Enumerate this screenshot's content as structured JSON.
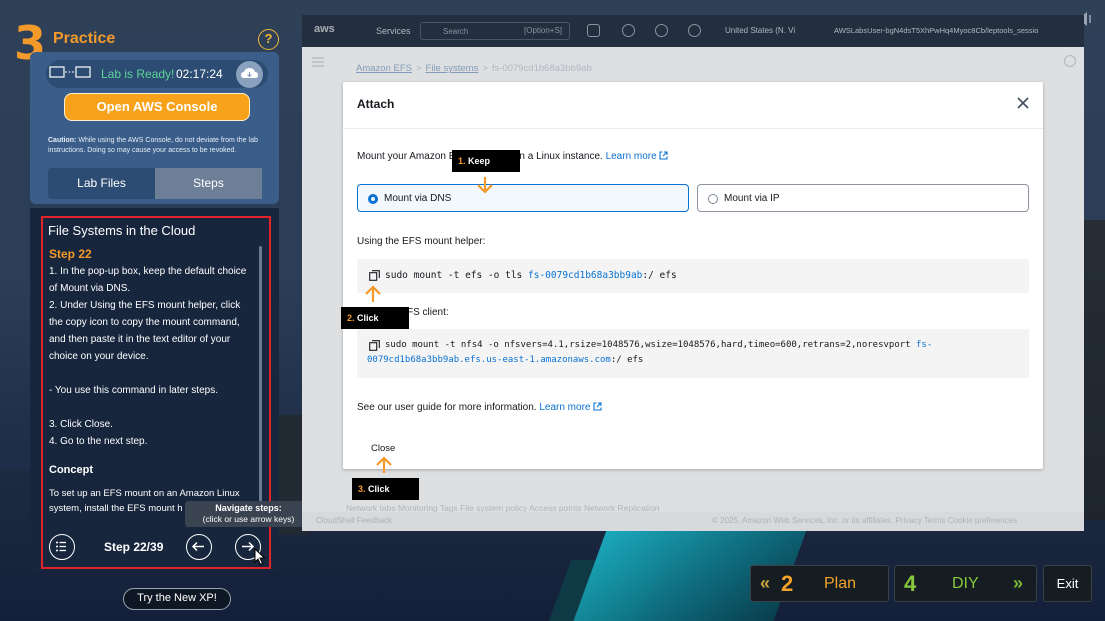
{
  "practice": {
    "number": "3",
    "title": "Practice",
    "help_label": "?"
  },
  "lab": {
    "status": "Lab is Ready!",
    "timer": "02:17:24",
    "open_console_label": "Open AWS Console",
    "caution_bold": "Caution:",
    "caution_text": "While using the AWS Console, do not deviate from the lab instructions. Doing so may cause your access to be revoked.",
    "tabs": [
      {
        "label": "Lab Files"
      },
      {
        "label": "Steps"
      }
    ]
  },
  "steps": {
    "title": "File Systems in the Cloud",
    "step_label": "Step 22",
    "lines": [
      "1. In the pop-up box, keep the default choice",
      "of Mount via DNS.",
      "2. Under Using the EFS mount helper, click",
      "the copy icon to copy the mount command,",
      "and then paste it in the text editor of your",
      "choice on your device.",
      "",
      "- You use this command in later steps.",
      "",
      "3. Click Close.",
      "4. Go to the next step."
    ],
    "concept_heading": "Concept",
    "concept_line1": "To set up an EFS mount on an Amazon Linux",
    "concept_line2": "system, install the EFS mount h",
    "tooltip_title": "Navigate steps:",
    "tooltip_sub": "(click or use arrow keys)",
    "counter": "Step 22/39",
    "try_new_xp": "Try the New XP!"
  },
  "console": {
    "top": {
      "logo": "aws",
      "services": "Services",
      "search_placeholder": "Search",
      "search_shortcut": "[Option+S]",
      "region": "United States (N. Vi",
      "user": "AWSLabsUser-bgN4dsT5XhPwHq4Myoc8Cb/leptools_sessio"
    },
    "breadcrumb": [
      "Amazon EFS",
      "File systems",
      "fs-0079cd1b68a3bb9ab"
    ],
    "behind_tabs": "Network tabs       Monitoring       Tags       File system policy       Access points       Network       Replication",
    "footer_left": "CloudShell      Feedback",
    "footer_right": "© 2025, Amazon Web Services, Inc. or its affiliates.      Privacy      Terms      Cookie preferences"
  },
  "modal": {
    "title": "Attach",
    "intro_pre": "Mount your Amazon E",
    "intro_post": "n a Linux instance.",
    "learn_more": "Learn more",
    "option_dns": "Mount via DNS",
    "option_ip": "Mount via IP",
    "helper_label": "Using the EFS mount helper:",
    "helper_cmd_pre": "sudo mount -t efs -o tls ",
    "helper_cmd_fs": "fs-0079cd1b68a3bb9ab",
    "helper_cmd_post": ":/ efs",
    "nfs_label": "FS client:",
    "nfs_cmd_line1_pre": "sudo mount -t nfs4 -o nfsvers=4.1,rsize=1048576,wsize=1048576,hard,timeo=600,retrans=2,noresvport ",
    "nfs_cmd_line1_fs": "fs-",
    "nfs_cmd_line2_fs": "0079cd1b68a3bb9ab.efs.us-east-1.amazonaws.com",
    "nfs_cmd_line2_post": ":/ efs",
    "guide_text": "See our user guide for more information.",
    "guide_link": "Learn more",
    "close_label": "Close"
  },
  "callouts": {
    "c1_num": "1.",
    "c1_text": "Keep",
    "c2_num": "2.",
    "c2_text": "Click",
    "c3_num": "3.",
    "c3_text": "Click"
  },
  "nav": {
    "plan_num": "2",
    "plan_label": "Plan",
    "diy_num": "4",
    "diy_label": "DIY",
    "exit_label": "Exit"
  },
  "colors": {
    "accent_orange": "#f39a2b",
    "aws_link": "#0972d3",
    "frame_red": "#e0242a",
    "diy_green": "#86c93e"
  }
}
